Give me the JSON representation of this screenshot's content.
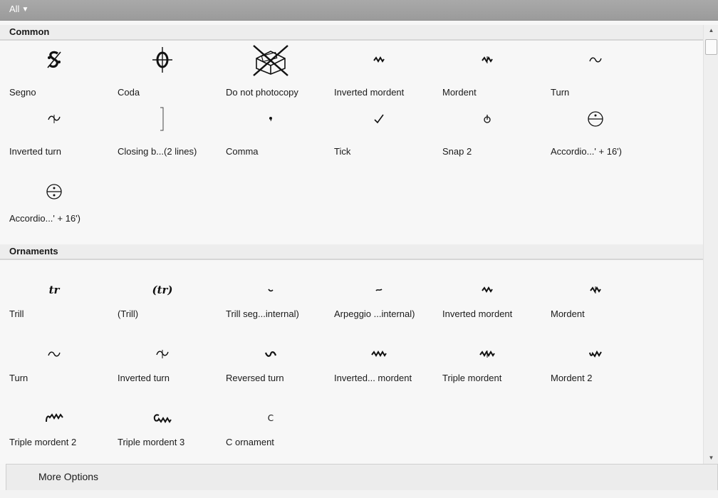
{
  "filter": {
    "label": "All",
    "caret": "▼"
  },
  "sections": [
    {
      "title": "Common",
      "items": [
        {
          "label": "Segno",
          "icon": "segno-icon"
        },
        {
          "label": "Coda",
          "icon": "coda-icon"
        },
        {
          "label": "Do not photocopy",
          "icon": "do-not-photocopy-icon"
        },
        {
          "label": "Inverted mordent",
          "icon": "inverted-mordent-icon"
        },
        {
          "label": "Mordent",
          "icon": "mordent-icon"
        },
        {
          "label": "Turn",
          "icon": "turn-icon"
        },
        {
          "label": "Inverted turn",
          "icon": "inverted-turn-icon"
        },
        {
          "label": "Closing b...(2 lines)",
          "icon": "closing-bracket-icon"
        },
        {
          "label": "Comma",
          "icon": "comma-icon"
        },
        {
          "label": "Tick",
          "icon": "tick-icon"
        },
        {
          "label": "Snap 2",
          "icon": "snap-icon"
        },
        {
          "label": "Accordio...' + 16')",
          "icon": "accordion-register-icon"
        },
        {
          "label": "Accordio...' + 16')",
          "icon": "accordion-register-icon"
        }
      ]
    },
    {
      "title": "Ornaments",
      "items": [
        {
          "label": "Trill",
          "icon": "trill-icon",
          "glyph": "tr"
        },
        {
          "label": "(Trill)",
          "icon": "trill-paren-icon",
          "glyph": "(tr)"
        },
        {
          "label": "Trill seg...internal)",
          "icon": "trill-segment-icon"
        },
        {
          "label": "Arpeggio ...internal)",
          "icon": "arpeggio-segment-icon"
        },
        {
          "label": "Inverted mordent",
          "icon": "inverted-mordent-icon"
        },
        {
          "label": "Mordent",
          "icon": "mordent-icon"
        },
        {
          "label": "Turn",
          "icon": "turn-icon"
        },
        {
          "label": "Inverted turn",
          "icon": "inverted-turn-icon"
        },
        {
          "label": "Reversed turn",
          "icon": "reversed-turn-icon"
        },
        {
          "label": "Inverted... mordent",
          "icon": "inverted-long-mordent-icon"
        },
        {
          "label": "Triple mordent",
          "icon": "triple-mordent-icon"
        },
        {
          "label": "Mordent 2",
          "icon": "mordent-2-icon"
        },
        {
          "label": "Triple mordent 2",
          "icon": "triple-mordent-2-icon"
        },
        {
          "label": "Triple mordent 3",
          "icon": "triple-mordent-3-icon"
        },
        {
          "label": "C ornament",
          "icon": "c-ornament-icon",
          "glyph": "C"
        }
      ]
    }
  ],
  "footer": {
    "more_options": "More Options"
  }
}
